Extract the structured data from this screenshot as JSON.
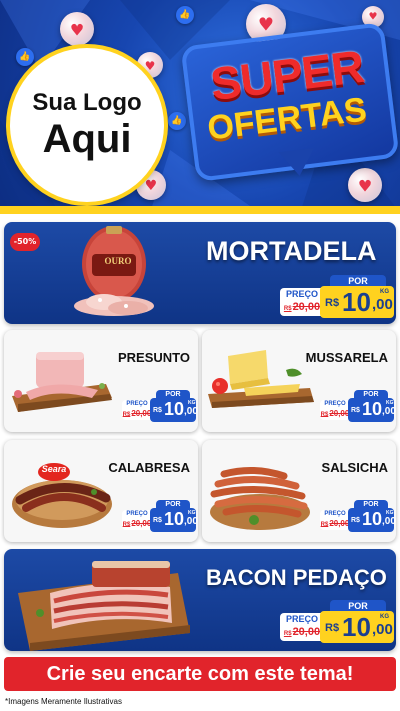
{
  "header": {
    "logo_line1": "Sua Logo",
    "logo_line2": "Aqui",
    "badge_line1": "SUPER",
    "badge_line2": "OFERTAS"
  },
  "colors": {
    "brand_blue": "#1d4aa6",
    "accent_yellow": "#ffd21f",
    "sale_red": "#e1242b"
  },
  "featured": [
    {
      "name": "MORTADELA",
      "discount": "-50%",
      "brand_on_package": "OURO",
      "por_label": "POR",
      "preco_label": "PREÇO",
      "old_currency": "R$",
      "old_price": "20,00",
      "currency": "R$",
      "price_int": "10",
      "price_dec": ",00",
      "unit": "KG"
    },
    {
      "name": "BACON PEDAÇO",
      "por_label": "POR",
      "preco_label": "PREÇO",
      "old_currency": "R$",
      "old_price": "20,00",
      "currency": "R$",
      "price_int": "10",
      "price_dec": ",00",
      "unit": "KG"
    }
  ],
  "grid": [
    {
      "name": "PRESUNTO",
      "por_label": "POR",
      "preco_label": "PREÇO",
      "old_currency": "R$",
      "old_price": "20,00",
      "currency": "R$",
      "price_int": "10",
      "price_dec": ",00",
      "unit": "KG"
    },
    {
      "name": "MUSSARELA",
      "por_label": "POR",
      "preco_label": "PREÇO",
      "old_currency": "R$",
      "old_price": "20,00",
      "currency": "R$",
      "price_int": "10",
      "price_dec": ",00",
      "unit": "KG"
    },
    {
      "name": "CALABRESA",
      "brand_on_package": "Seara",
      "por_label": "POR",
      "preco_label": "PREÇO",
      "old_currency": "R$",
      "old_price": "20,00",
      "currency": "R$",
      "price_int": "10",
      "price_dec": ",00",
      "unit": "KG"
    },
    {
      "name": "SALSICHA",
      "por_label": "POR",
      "preco_label": "PREÇO",
      "old_currency": "R$",
      "old_price": "20,00",
      "currency": "R$",
      "price_int": "10",
      "price_dec": ",00",
      "unit": "KG"
    }
  ],
  "cta": "Crie seu encarte com este tema!",
  "disclaimer": "*Imagens Meramente Ilustrativas",
  "icons": [
    "heart-bubble-icon",
    "thumbs-up-icon"
  ]
}
